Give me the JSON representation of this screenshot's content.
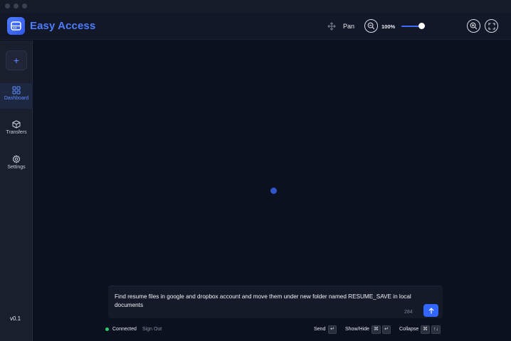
{
  "app": {
    "title": "Easy Access"
  },
  "toolbar": {
    "pan_label": "Pan",
    "zoom_value": "100%",
    "zoom_level": 1.0,
    "icons": [
      "pan-icon",
      "zoom-out-icon",
      "zoom-in-icon",
      "fullscreen-icon"
    ]
  },
  "sidebar": {
    "new_button": "+",
    "items": [
      {
        "label": "Dashboard",
        "icon": "grid-icon",
        "active": true
      },
      {
        "label": "Transfers",
        "icon": "box-icon",
        "active": false
      },
      {
        "label": "Settings",
        "icon": "gear-icon",
        "active": false
      }
    ],
    "version": "v0.1"
  },
  "chat": {
    "input_value": "Find resume files in google and dropbox account and move them under new folder named RESUME_SAVE in local documents",
    "char_count": "284"
  },
  "status_bar": {
    "status": "Connected",
    "sign_out": "Sign Out",
    "send_label": "Send",
    "show_hide_label": "Show/Hide",
    "collapse_label": "Collapse",
    "keys": {
      "enter": "↵",
      "cmd": "⌘",
      "arrows": "↑↓"
    }
  },
  "colors": {
    "accent": "#3e6cff",
    "title": "#4c7dff",
    "background": "#0c1120",
    "connected": "#33cc66"
  }
}
